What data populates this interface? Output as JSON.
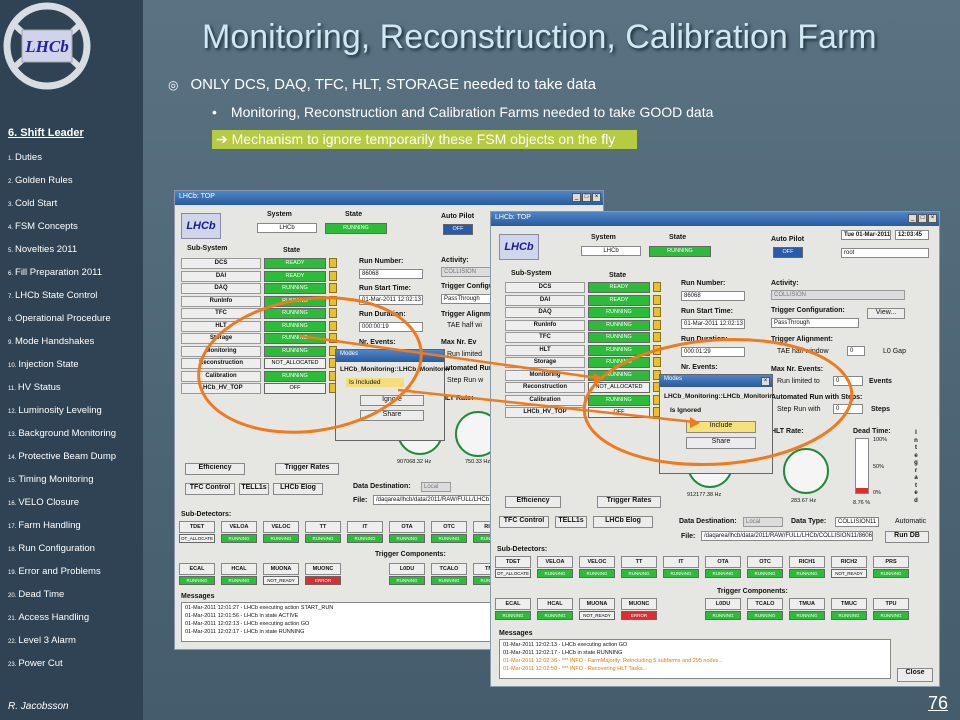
{
  "slide": {
    "title": "Monitoring, Reconstruction, Calibration Farm",
    "bullet1": "ONLY DCS, DAQ, TFC, HLT, STORAGE needed to take data",
    "bullet1_mark": "◎",
    "bullet2": "Monitoring, Reconstruction and Calibration Farms needed to take GOOD data",
    "bullet2_mark": "•",
    "bullet3": "➔ Mechanism to ignore temporarily these FSM objects on the fly",
    "page_number": "76",
    "highlight_color": "#b5cc42",
    "oval_color": "#f07a1e"
  },
  "sidebar": {
    "logo_text": "LHCb",
    "section_title": "6. Shift Leader",
    "author": "R. Jacobsson",
    "items": [
      {
        "num": "1.",
        "label": "Duties"
      },
      {
        "num": "2.",
        "label": "Golden Rules"
      },
      {
        "num": "3.",
        "label": "Cold Start"
      },
      {
        "num": "4.",
        "label": "FSM Concepts"
      },
      {
        "num": "5.",
        "label": "Novelties 2011"
      },
      {
        "num": "6.",
        "label": "Fill Preparation 2011"
      },
      {
        "num": "7.",
        "label": "LHCb State Control"
      },
      {
        "num": "8.",
        "label": "Operational Procedure"
      },
      {
        "num": "9.",
        "label": "Mode Handshakes"
      },
      {
        "num": "10.",
        "label": "Injection State"
      },
      {
        "num": "11.",
        "label": "HV Status"
      },
      {
        "num": "12.",
        "label": "Luminosity Leveling"
      },
      {
        "num": "13.",
        "label": "Background Monitoring"
      },
      {
        "num": "14.",
        "label": "Protective Beam Dump"
      },
      {
        "num": "15.",
        "label": "Timing Monitoring"
      },
      {
        "num": "16.",
        "label": "VELO Closure"
      },
      {
        "num": "17.",
        "label": "Farm Handling"
      },
      {
        "num": "18.",
        "label": "Run Configuration"
      },
      {
        "num": "19.",
        "label": "Error and Problems"
      },
      {
        "num": "20.",
        "label": "Dead Time"
      },
      {
        "num": "21.",
        "label": "Access Handling"
      },
      {
        "num": "22.",
        "label": "Level 3 Alarm"
      },
      {
        "num": "23.",
        "label": "Power Cut"
      }
    ]
  },
  "win1": {
    "title": "LHCb: TOP",
    "logo": "LHCb",
    "system_label": "System",
    "system_value": "LHCb",
    "state_label": "State",
    "state_value": "RUNNING",
    "autopilot_label": "Auto Pilot",
    "autopilot_value": "OFF",
    "subsystem_label": "Sub-System",
    "substate_label": "State",
    "subsystems": [
      {
        "name": "DCS",
        "state": "READY",
        "cls": "ready"
      },
      {
        "name": "DAI",
        "state": "READY",
        "cls": "ready"
      },
      {
        "name": "DAQ",
        "state": "RUNNING",
        "cls": "run"
      },
      {
        "name": "RunInfo",
        "state": "RUNNING",
        "cls": "run"
      },
      {
        "name": "TFC",
        "state": "RUNNING",
        "cls": "run"
      },
      {
        "name": "HLT",
        "state": "RUNNING",
        "cls": "run"
      },
      {
        "name": "Storage",
        "state": "RUNNING",
        "cls": "run"
      },
      {
        "name": "Monitoring",
        "state": "RUNNING",
        "cls": "run"
      },
      {
        "name": "Reconstruction",
        "state": "NOT_ALLOCATED",
        "cls": "wide-state"
      },
      {
        "name": "Calibration",
        "state": "RUNNING",
        "cls": "run"
      },
      {
        "name": "LHCb_HV_TOP",
        "state": "OFF",
        "cls": "wide-state"
      }
    ],
    "run_number_label": "Run Number:",
    "run_number": "86068",
    "run_start_label": "Run Start Time:",
    "run_start": "01-Mar-2011 12:02:13",
    "run_duration_label": "Run Duration:",
    "run_duration": "000:00:19",
    "nr_events_label": "Nr. Events:",
    "activity_label": "Activity:",
    "activity": "COLLISION",
    "trigger_config_label": "Trigger Configur",
    "trigger_config": "PassThrough",
    "trigger_align_label": "Trigger Alignment",
    "tae_label": "TAE half wi",
    "max_events_label": "Max Nr. Ev",
    "run_limited_label": "Run limited",
    "automated_label": "Automated Run",
    "step_run_label": "Step Run w",
    "hlt_rate_label": "HLT Rate:",
    "gauge1_value": "907068.32 Hz",
    "gauge2_value": "750.33 Hz",
    "efficiency": "Efficiency",
    "trigger_rates": "Trigger Rates",
    "tfc_control": "TFC Control",
    "tell1s": "TELL1s",
    "lhcb_elog": "LHCb Elog",
    "data_dest_label": "Data Destination:",
    "data_dest": "Local",
    "file_label": "File:",
    "file": "/daqarea/lhcb/data/2011/RAW/FULL/LHCb",
    "subdetectors_label": "Sub-Detectors:",
    "detectors_row1": [
      "TDET",
      "VELOA",
      "VELOC",
      "TT",
      "IT",
      "OTA",
      "OTC",
      "RICH"
    ],
    "detectors_row1_state": [
      "OT_ALLOCATE",
      "RUNNING",
      "RUNNING",
      "RUNNING",
      "RUNNING",
      "RUNNING",
      "RUNNING",
      "RUNNING"
    ],
    "trigger_components_label": "Trigger Components:",
    "detectors_row2": [
      "ECAL",
      "HCAL",
      "MUONA",
      "MUONC",
      "",
      "L0DU",
      "TCALO",
      "TMU"
    ],
    "detectors_row2_state": [
      "RUNNING",
      "RUNNING",
      "NOT_READY",
      "ERROR",
      "",
      "RUNNING",
      "RUNNING",
      "RUNNING"
    ],
    "messages_label": "Messages",
    "messages": [
      "01-Mar-2011 12:01:27 - LHCb executing action START_RUN",
      "01-Mar-2011 12:01:56 - LHCb in state ACTIVE",
      "01-Mar-2011 12:02:13 - LHCb executing action GO",
      "01-Mar-2011 12:02:17 - LHCb in state RUNNING"
    ],
    "dialog_title": "Modes",
    "dialog_node": "LHCb_Monitoring::LHCb_Monitorin",
    "dialog_status": "Is Included",
    "dialog_btn1": "Ignore",
    "dialog_btn2": "Share"
  },
  "win2": {
    "title": "LHCb: TOP",
    "logo": "LHCb",
    "date": "Tue 01-Mar-2011",
    "time": "12:03:45",
    "user": "root",
    "system_label": "System",
    "system_value": "LHCb",
    "state_label": "State",
    "state_value": "RUNNING",
    "autopilot_label": "Auto Pilot",
    "autopilot_value": "OFF",
    "subsystem_label": "Sub-System",
    "substate_label": "State",
    "subsystems": [
      {
        "name": "DCS",
        "state": "READY",
        "cls": "ready"
      },
      {
        "name": "DAI",
        "state": "READY",
        "cls": "ready"
      },
      {
        "name": "DAQ",
        "state": "RUNNING",
        "cls": "run"
      },
      {
        "name": "RunInfo",
        "state": "RUNNING",
        "cls": "run"
      },
      {
        "name": "TFC",
        "state": "RUNNING",
        "cls": "run"
      },
      {
        "name": "HLT",
        "state": "RUNNING",
        "cls": "run"
      },
      {
        "name": "Storage",
        "state": "RUNNING",
        "cls": "run"
      },
      {
        "name": "Monitoring",
        "state": "RUNNING",
        "cls": "run"
      },
      {
        "name": "Reconstruction",
        "state": "NOT_ALLOCATED",
        "cls": "wide-state"
      },
      {
        "name": "Calibration",
        "state": "RUNNING",
        "cls": "run"
      },
      {
        "name": "LHCb_HV_TOP",
        "state": "OFF",
        "cls": "wide-state"
      }
    ],
    "run_number_label": "Run Number:",
    "run_number": "86068",
    "run_start_label": "Run Start Time:",
    "run_start": "01-Mar-2011 12:02:13",
    "run_duration_label": "Run Duration:",
    "run_duration": "000:01:29",
    "nr_events_label": "Nr. Events:",
    "activity_label": "Activity:",
    "activity": "COLLISION",
    "trigger_config_label": "Trigger Configuration:",
    "trigger_config": "PassThrough",
    "view_btn": "View...",
    "trigger_align_label": "Trigger Alignment:",
    "tae_label": "TAE half window",
    "tae_value": "0",
    "l0gap_label": "L0 Gap",
    "max_events_label": "Max Nr. Events:",
    "run_limited_label": "Run limited to",
    "run_limited_value": "0",
    "events_label": "Events",
    "automated_label": "Automated Run with Steps:",
    "step_run_label": "Step Run with",
    "step_value": "0",
    "steps_label": "Steps",
    "hlt_rate_label": "HLT Rate:",
    "dead_time_label": "Dead Time:",
    "dead_100": "100%",
    "dead_50": "50%",
    "dead_0": "0%",
    "dead_value": "8.76 %",
    "integrated": [
      "I",
      "n",
      "t",
      "e",
      "g",
      "r",
      "a",
      "t",
      "e",
      "d"
    ],
    "gauge1_value": "912177.38 Hz",
    "gauge2_value": "283.67 Hz",
    "efficiency": "Efficiency",
    "trigger_rates": "Trigger Rates",
    "tfc_control": "TFC Control",
    "tell1s": "TELL1s",
    "lhcb_elog": "LHCb Elog",
    "data_dest_label": "Data Destination:",
    "data_dest": "Local",
    "data_type_label": "Data Type:",
    "data_type": "COLLISION11",
    "automatic_label": "Automatic",
    "file_label": "File:",
    "file": "/daqarea/lhcb/data/2011/RAW/FULL/LHCb/COLLISION11/86068",
    "run_db": "Run DB",
    "subdetectors_label": "Sub-Detectors:",
    "detectors_row1": [
      "TDET",
      "VELOA",
      "VELOC",
      "TT",
      "IT",
      "OTA",
      "OTC",
      "RICH1",
      "RICH2",
      "PRS"
    ],
    "detectors_row1_state": [
      "OT_ALLOCATE",
      "RUNNING",
      "RUNNING",
      "RUNNING",
      "RUNNING",
      "RUNNING",
      "RUNNING",
      "RUNNING",
      "NOT_READY",
      "RUNNING"
    ],
    "trigger_components_label": "Trigger Components:",
    "detectors_row2": [
      "ECAL",
      "HCAL",
      "MUONA",
      "MUONC",
      "",
      "L0DU",
      "TCALO",
      "TMUA",
      "TMUC",
      "TPU"
    ],
    "detectors_row2_state": [
      "RUNNING",
      "RUNNING",
      "NOT_READY",
      "ERROR",
      "",
      "RUNNING",
      "RUNNING",
      "RUNNING",
      "RUNNING",
      "RUNNING"
    ],
    "messages_label": "Messages",
    "messages": [
      "01-Mar-2011 12:02:13 - LHCb executing action GO",
      "01-Mar-2011 12:02:17 - LHCb in state RUNNING",
      "01-Mar-2011 12:02:36 - *** INFO - FarmMajority: Reincluding 5 subfarms and 295 nodes...",
      "01-Mar-2011 12:02:50 - *** INFO - Recovering HLT Tasks..."
    ],
    "close_btn": "Close",
    "dialog_title": "Modes",
    "dialog_node": "LHCb_Monitoring::LHCb_Monitorin",
    "dialog_status": "Is Ignored",
    "dialog_btn1": "Include",
    "dialog_btn2": "Share"
  }
}
